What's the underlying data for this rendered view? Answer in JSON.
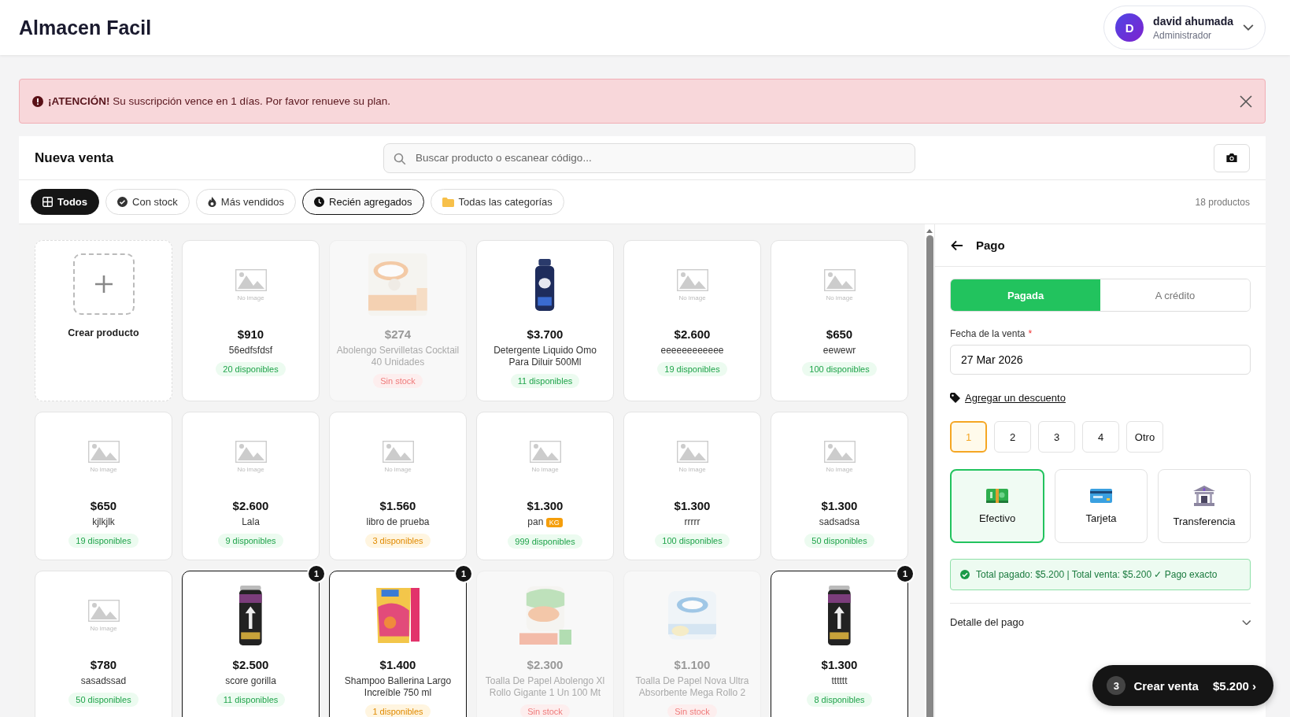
{
  "header": {
    "brand": "Almacen Facil",
    "user": {
      "initial": "D",
      "name": "david ahumada",
      "role": "Administrador"
    }
  },
  "alert": {
    "text": "**¡ATENCIÓN!** Su suscripción vence en 1 días. Por favor renueve su plan."
  },
  "sale": {
    "title": "Nueva venta",
    "search": {
      "placeholder": "Buscar producto o escanear código..."
    },
    "chips": [
      {
        "label": "Todos",
        "kind": "filter",
        "selected": true
      },
      {
        "label": "Con stock",
        "kind": "filter",
        "selected": false
      },
      {
        "label": "Más vendidos",
        "kind": "filter",
        "selected": false
      },
      {
        "label": "Recién agregados",
        "kind": "sort",
        "selected": true
      },
      {
        "label": "Todas las categorías",
        "kind": "category",
        "selected": false
      }
    ],
    "count": "18 productos",
    "create": {
      "label": "Crear producto"
    },
    "products": [
      {
        "kind": "placeholder",
        "image_label": "No image",
        "price": "$910",
        "name": "56edfsfdsf",
        "stock": "20 disponibles",
        "available": true,
        "low": false,
        "selected": false
      },
      {
        "kind": "picture",
        "price": "$274",
        "name": "Abolengo Servilletas Cocktail 40 Unidades",
        "stock": "Sin stock",
        "available": false,
        "selected": false
      },
      {
        "kind": "picture",
        "price": "$3.700",
        "name": "Detergente Liquido Omo Para Diluir 500Ml",
        "stock": "11 disponibles",
        "available": true,
        "low": false,
        "selected": false
      },
      {
        "kind": "placeholder",
        "image_label": "No image",
        "price": "$2.600",
        "name": "eeeeeeeeeeee",
        "stock": "19 disponibles",
        "available": true,
        "low": false,
        "selected": false
      },
      {
        "kind": "placeholder",
        "image_label": "No image",
        "price": "$650",
        "name": "eewewr",
        "stock": "100 disponibles",
        "available": true,
        "low": false,
        "selected": false
      },
      {
        "kind": "placeholder",
        "image_label": "No image",
        "price": "$650",
        "name": "kjlkjlk",
        "stock": "19 disponibles",
        "available": true,
        "low": false,
        "selected": false
      },
      {
        "kind": "placeholder",
        "image_label": "No image",
        "price": "$2.600",
        "name": "Lala",
        "stock": "9 disponibles",
        "available": true,
        "low": false,
        "selected": false
      },
      {
        "kind": "placeholder",
        "image_label": "No image",
        "price": "$1.560",
        "name": "libro de prueba",
        "stock": "3 disponibles",
        "available": true,
        "low": true,
        "selected": false
      },
      {
        "kind": "placeholder",
        "image_label": "No image",
        "price": "$1.300",
        "name": "pan",
        "unit": "KG",
        "stock": "999 disponibles",
        "available": true,
        "low": false,
        "selected": false
      },
      {
        "kind": "placeholder",
        "image_label": "No image",
        "price": "$1.300",
        "name": "rrrrr",
        "stock": "100 disponibles",
        "available": true,
        "low": false,
        "selected": false
      },
      {
        "kind": "placeholder",
        "image_label": "No image",
        "price": "$1.300",
        "name": "sadsadsa",
        "stock": "50 disponibles",
        "available": true,
        "low": false,
        "selected": false
      },
      {
        "kind": "placeholder",
        "image_label": "No image",
        "price": "$780",
        "name": "sasadssad",
        "stock": "50 disponibles",
        "available": true,
        "low": false,
        "selected": false
      },
      {
        "kind": "picture",
        "price": "$2.500",
        "name": "score gorilla",
        "stock": "11 disponibles",
        "available": true,
        "low": false,
        "selected": true,
        "quantity": "1"
      },
      {
        "kind": "picture",
        "price": "$1.400",
        "name": "Shampoo Ballerina Largo Increíble 750 ml",
        "stock": "1 disponibles",
        "available": true,
        "low": true,
        "selected": true,
        "quantity": "1"
      },
      {
        "kind": "picture",
        "price": "$2.300",
        "name": "Toalla De Papel Abolengo Xl Rollo Gigante 1 Un 100 Mt",
        "stock": "Sin stock",
        "available": false,
        "selected": false
      },
      {
        "kind": "picture",
        "price": "$1.100",
        "name": "Toalla De Papel Nova Ultra Absorbente Mega Rollo 2",
        "stock": "Sin stock",
        "available": false,
        "selected": false
      },
      {
        "kind": "picture",
        "price": "$1.300",
        "name": "tttttt",
        "stock": "8 disponibles",
        "available": true,
        "low": false,
        "selected": true,
        "quantity": "1"
      }
    ]
  },
  "payment": {
    "title": "Pago",
    "status_tabs": [
      {
        "label": "Pagada",
        "selected": true
      },
      {
        "label": "A crédito",
        "selected": false
      }
    ],
    "date": {
      "label": "Fecha de la venta",
      "required_mark": "*",
      "value": "27 Mar 2026"
    },
    "discount_link": "Agregar un descuento",
    "installments": [
      {
        "label": "1",
        "selected": true
      },
      {
        "label": "2",
        "selected": false
      },
      {
        "label": "3",
        "selected": false
      },
      {
        "label": "4",
        "selected": false
      },
      {
        "label": "Otro",
        "selected": false
      }
    ],
    "methods": [
      {
        "label": "Efectivo",
        "selected": true
      },
      {
        "label": "Tarjeta",
        "selected": false
      },
      {
        "label": "Transferencia",
        "selected": false
      }
    ],
    "summary": "Total pagado: $5.200 | Total venta: $5.200 ✓ Pago exacto",
    "detail": {
      "label": "Detalle del pago",
      "expanded": false
    }
  },
  "checkout": {
    "count": "3",
    "label": "Crear venta",
    "total": "$5.200",
    "chevron": "›"
  }
}
